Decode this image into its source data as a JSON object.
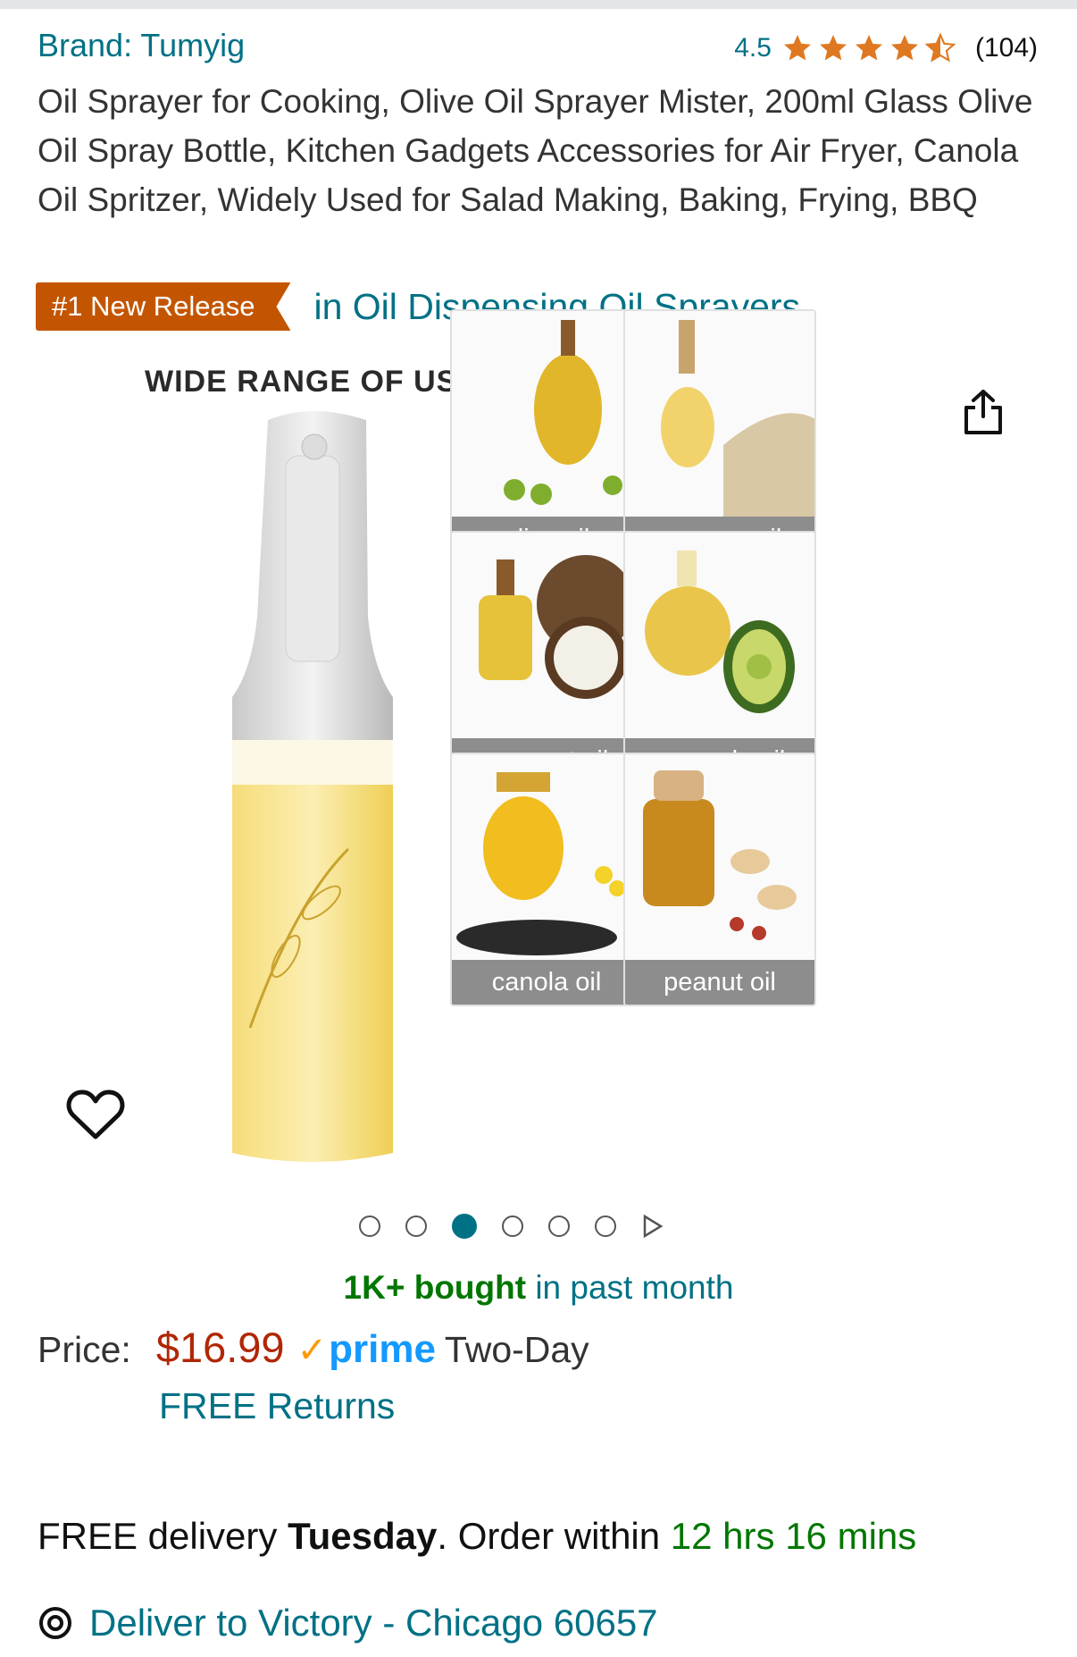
{
  "product": {
    "brand": "Brand: Tumyig",
    "rating_value": "4.5",
    "rating_stars": 4.5,
    "review_count": "(104)",
    "title": "Oil Sprayer for Cooking, Olive Oil Sprayer Mister, 200ml Glass Olive Oil Spray Bottle, Kitchen Gadgets Accessories for Air Fryer, Canola Oil Spritzer, Widely Used for Salad Making, Baking, Frying, BBQ",
    "badge": "#1 New Release",
    "badge_category": "in Oil Dispensing Oil Sprayers"
  },
  "gallery": {
    "image_title": "WIDE RANGE OF USES",
    "tiles": [
      "olive oil",
      "sesame oil",
      "coconut oil",
      "avocado oil",
      "canola oil",
      "peanut oil"
    ],
    "page_count": 6,
    "active_index": 2
  },
  "purchase": {
    "bought_bold": "1K+ bought",
    "bought_rest": " in past month",
    "price_label": "Price:",
    "price": "$16.99",
    "prime_label": "prime",
    "prime_speed": "Two-Day",
    "returns": "FREE Returns",
    "delivery_prefix": "FREE delivery ",
    "delivery_day": "Tuesday",
    "delivery_mid": ". Order within ",
    "delivery_countdown": "12 hrs 16 mins",
    "deliver_to": "Deliver to Victory - Chicago 60657"
  },
  "colors": {
    "link": "#007185",
    "badge": "#c45500",
    "price": "#b12704",
    "prime": "#1399ff",
    "star": "#de7921",
    "green": "#007600"
  },
  "icons": [
    "star-icon",
    "share-icon",
    "heart-icon",
    "location-pin-icon",
    "play-next-icon",
    "check-icon"
  ]
}
